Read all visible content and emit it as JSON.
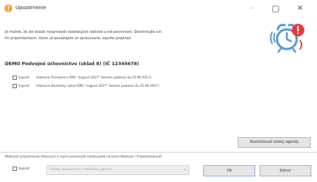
{
  "window": {
    "title": "Upozornenie",
    "min_glyph": "–",
    "max_glyph": "▢",
    "close_glyph": "✕"
  },
  "info": {
    "line1": "Je možné, že ste dosiaľ nesplnovali nasledujúce daňové a iné povinnosti. Skontrolujte ich.",
    "line2": "Pri pripomienkach, ktoré už považujete za spracované, zaprite prepínač."
  },
  "company": {
    "title": "DEMO Podvojné účtovníctvo (sklad 8) (IČ 12345678)"
  },
  "items": [
    {
      "checkbox_label": "Vypnúť",
      "text": "Hlásenie Priznanie k DPH \"august 2017\" (termín podania do 25.09.2017)"
    },
    {
      "checkbox_label": "Vypnúť",
      "text": "Hlásenie Kontrolný výkaz DPH \"august 2017\" (termín podania do 25.09.2017)"
    }
  ],
  "buttons": {
    "check_all": "Skontrolovať všetky agendy",
    "ok": "OK",
    "close": "Zatvor"
  },
  "footer": {
    "note": "Možnosti pripomienok daňových a iných povinností nastavujete na karte Nástroje / Pripomienkovač.",
    "postpone_label": "Vypnúť",
    "select_value": "Všetky upozornenia z aktuálnej agendy"
  },
  "colors": {
    "alarm_blue": "#4a90d0",
    "alarm_red": "#e0393e",
    "ok_border": "#8aa8d8"
  },
  "icons": {
    "app": "warning-app-icon",
    "alarm": "alarm-clock-icon"
  }
}
